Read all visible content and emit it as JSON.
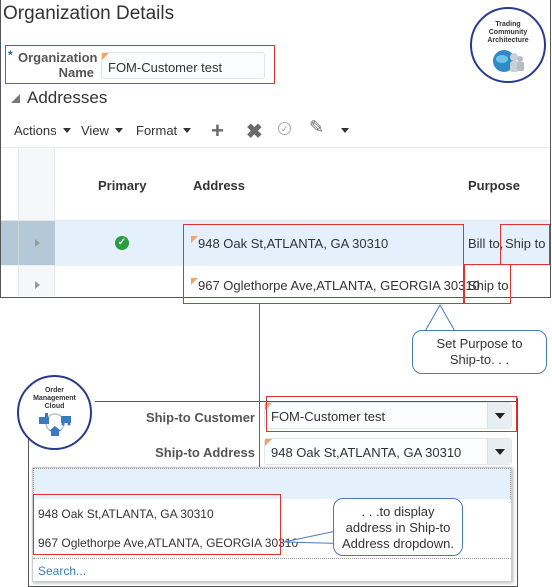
{
  "upper": {
    "title": "Organization Details",
    "org_name": {
      "required_mark": "*",
      "label_line1": "Organization",
      "label_line2": "Name",
      "value": "FOM-Customer test"
    },
    "section_title": "Addresses",
    "toolbar": {
      "actions": "Actions",
      "view": "View",
      "format": "Format",
      "add_icon": "plus-icon",
      "delete_icon": "x-icon",
      "confirm_icon": "check-circle-icon",
      "edit_icon": "pencil-icon"
    },
    "table": {
      "columns": [
        "Primary",
        "Address",
        "Purpose"
      ],
      "rows": [
        {
          "primary": true,
          "address": "948 Oak St,ATLANTA, GA 30310",
          "purpose_1": "Bill to,",
          "purpose_2": "Ship to",
          "selected": true
        },
        {
          "primary": false,
          "address": "967 Oglethorpe Ave,ATLANTA, GEORGIA 30310",
          "purpose_1": "Ship to",
          "purpose_2": "",
          "selected": false
        }
      ]
    }
  },
  "badges": {
    "tca_line1": "Trading",
    "tca_line2": "Community",
    "tca_line3": "Architecture",
    "omc_line1": "Order",
    "omc_line2": "Management",
    "omc_line3": "Cloud"
  },
  "callouts": {
    "purpose_line1": "Set Purpose to",
    "purpose_line2": "Ship-to. . .",
    "display_line1": ". . .to display",
    "display_line2": "address in Ship-to",
    "display_line3": "Address dropdown."
  },
  "lower": {
    "ship_to_customer_label": "Ship-to Customer",
    "ship_to_customer_value": "FOM-Customer test",
    "ship_to_address_label": "Ship-to Address",
    "ship_to_address_value": "948 Oak St,ATLANTA, GA 30310",
    "dropdown": {
      "options": [
        "948 Oak St,ATLANTA, GA 30310",
        "967 Oglethorpe Ave,ATLANTA, GEORGIA 30310"
      ],
      "search_link": "Search..."
    }
  },
  "colors": {
    "highlight_red": "#dd3333",
    "selected_row": "#e4f0fc",
    "link_blue": "#3a7ab8",
    "check_green": "#2a9d3c"
  }
}
